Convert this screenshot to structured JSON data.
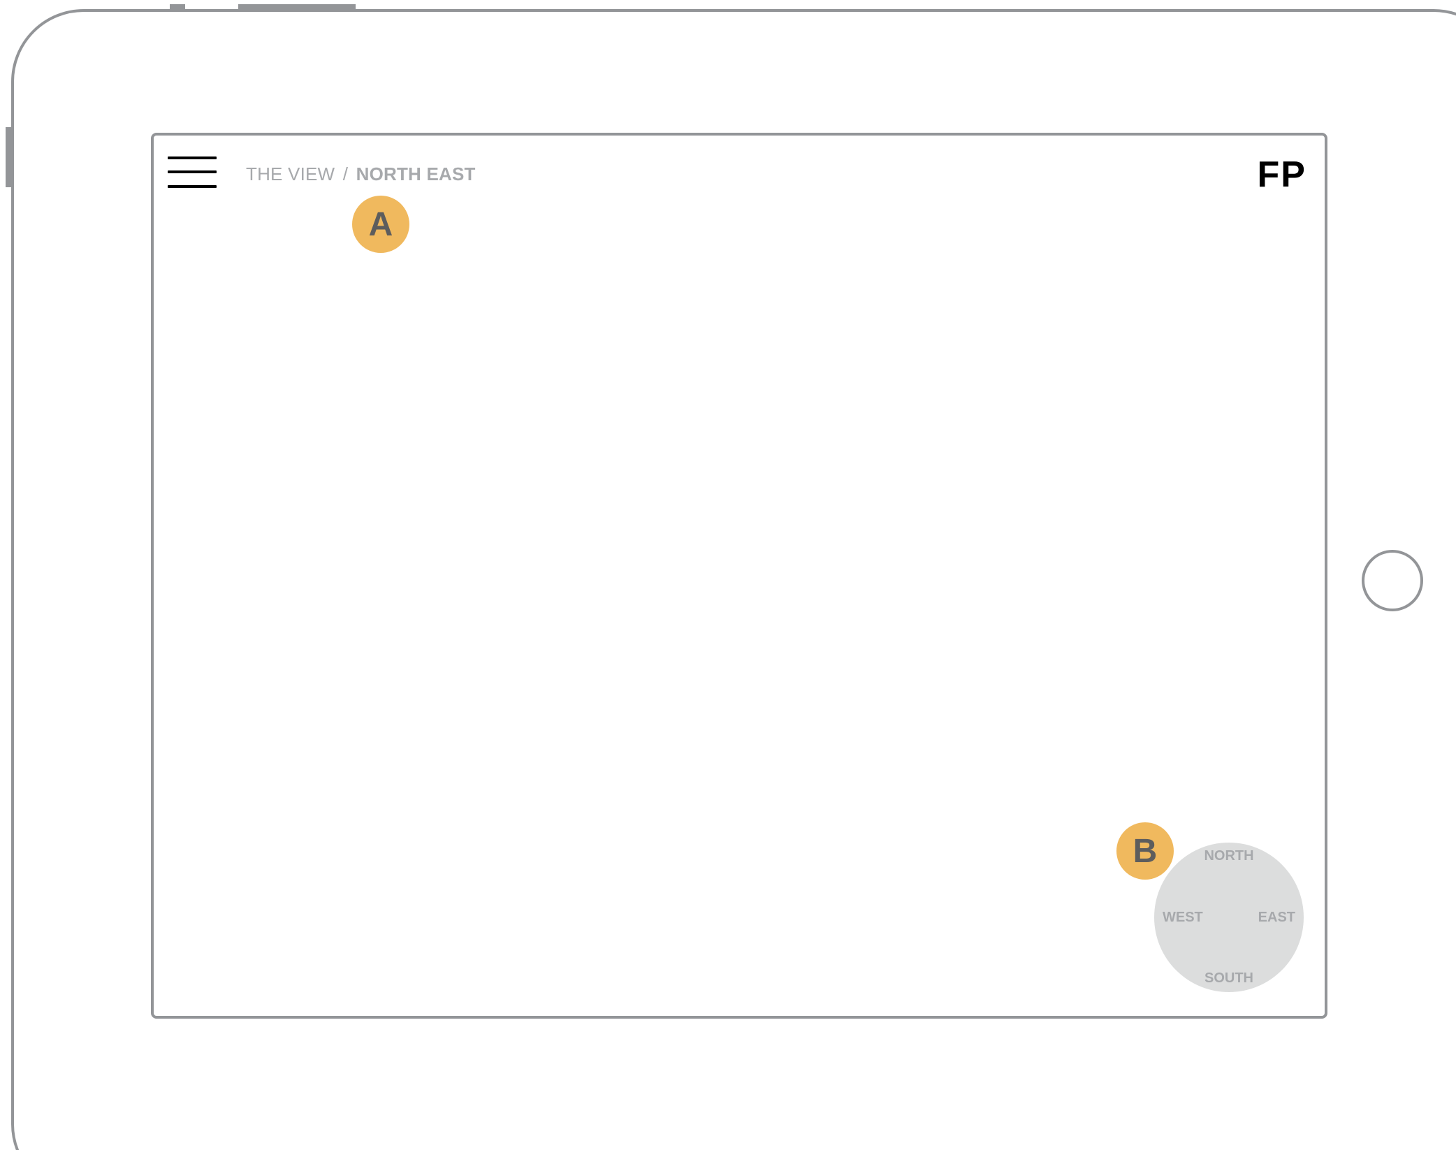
{
  "header": {
    "menu_icon": "hamburger-menu-icon",
    "breadcrumb": {
      "root": "THE VIEW",
      "separator": "/",
      "current": "NORTH EAST"
    },
    "logo": "FP"
  },
  "annotations": {
    "a": "A",
    "b": "B"
  },
  "compass": {
    "north": "NORTH",
    "south": "SOUTH",
    "west": "WEST",
    "east": "EAST"
  },
  "colors": {
    "device_outline": "#939598",
    "annotation_marker": "#f0b95e",
    "compass_fill": "#dcdddd",
    "muted_text": "#a7a9ac"
  }
}
